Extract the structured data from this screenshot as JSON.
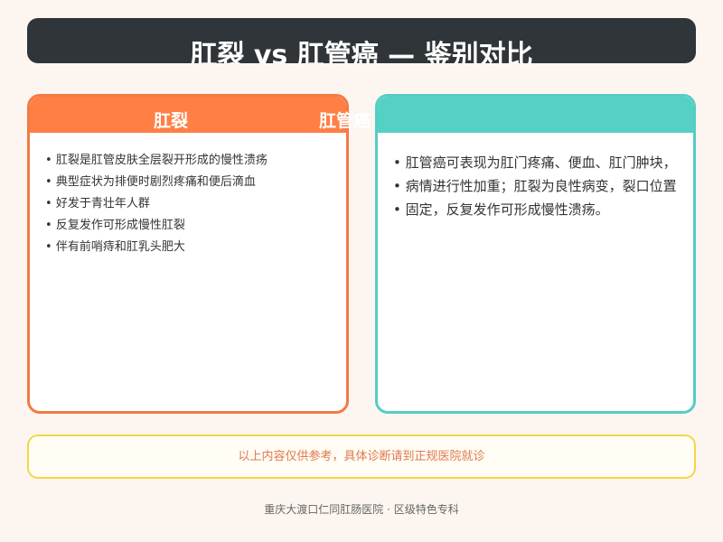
{
  "title": "肛裂 vs 肛管癌 — 鉴别对比",
  "left_card": {
    "header": "肛裂",
    "items": [
      "肛裂是肛管皮肤全层裂开形成的慢性溃疡",
      "典型症状为排便时剧烈疼痛和便后滴血",
      "好发于青壮年人群",
      "反复发作可形成慢性肛裂",
      "伴有前哨痔和肛乳头肥大"
    ]
  },
  "right_card": {
    "header": "肛管癌",
    "items": [
      "肛管癌可表现为肛门疼痛、便血、肛门肿块，",
      "病情进行性加重；肛裂为良性病变，裂口位置",
      "固定，反复发作可形成慢性溃疡。"
    ]
  },
  "note": "以上内容仅供参考，具体诊断请到正规医院就诊",
  "footer": "重庆大渡口仁同肛肠医院 · 区级特色专科",
  "colors": {
    "title_bg": "#2f3538",
    "left_accent": "#ff7f45",
    "right_accent": "#55d0c4",
    "note_border": "#f5d547",
    "note_text": "#e0784f",
    "page_bg": "#fdf6f0"
  }
}
